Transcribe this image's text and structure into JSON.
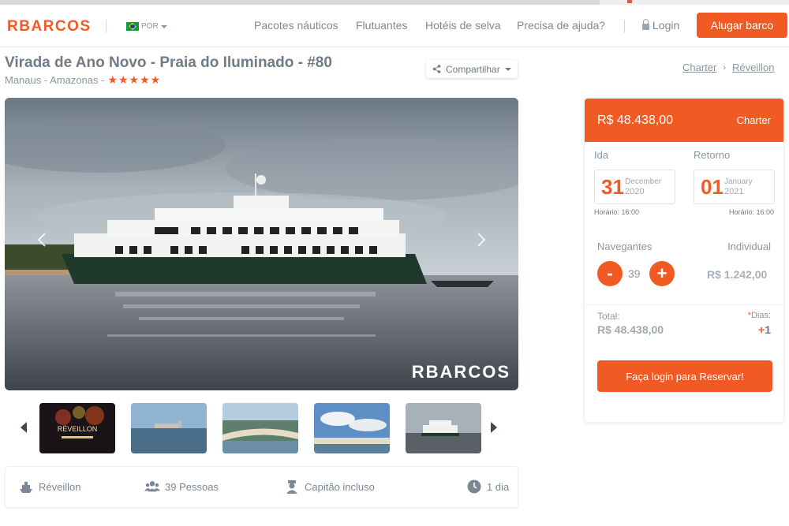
{
  "colors": {
    "brand": "#f15a22",
    "text": "#7a8794"
  },
  "header": {
    "logo": "RBARCOS",
    "language": "POR",
    "nav": [
      "Pacotes náuticos",
      "Flutuantes",
      "Hotéis de selva",
      "Precisa de ajuda?"
    ],
    "login": "Login",
    "cta": "Alugar barco"
  },
  "listing": {
    "title": "Virada de Ano Novo - Praia do Iluminado - #80",
    "location": "Manaus - Amazonas -",
    "rating_stars": 5,
    "share": "Compartilhar",
    "breadcrumb": [
      "Charter",
      "Réveillon"
    ],
    "watermark": "RBARCOS"
  },
  "thumbnails": [
    {
      "name": "thumb-reveillon",
      "caption": "RÉVEILLON"
    },
    {
      "name": "thumb-river-city",
      "caption": ""
    },
    {
      "name": "thumb-beach-aerial",
      "caption": ""
    },
    {
      "name": "thumb-sky-beach",
      "caption": ""
    },
    {
      "name": "thumb-boat",
      "caption": ""
    }
  ],
  "features": [
    {
      "icon": "boat-icon",
      "label": "Réveillon"
    },
    {
      "icon": "people-icon",
      "label": "39 Pessoas"
    },
    {
      "icon": "captain-icon",
      "label": "Capitão incluso"
    },
    {
      "icon": "clock-icon",
      "label": "1 dia"
    }
  ],
  "booking": {
    "price": "R$ 48.438,00",
    "type": "Charter",
    "ida_label": "Ida",
    "retorno_label": "Retorno",
    "ida": {
      "day": "31",
      "month": "December",
      "year": "2020",
      "time": "Horário: 16:00"
    },
    "retorno": {
      "day": "01",
      "month": "January",
      "year": "2021",
      "time": "Horário: 16:00"
    },
    "navegantes_label": "Navegantes",
    "individual_label": "Individual",
    "minus": "-",
    "plus": "+",
    "quantity": "39",
    "individual_price": "R$ 1.242,00",
    "total_label": "Total:",
    "total": "R$ 48.438,00",
    "dias_star": "*",
    "dias_label": "Dias:",
    "dias_plus": "+",
    "dias_value": "1",
    "reserve": "Faça login para Reservar!"
  }
}
